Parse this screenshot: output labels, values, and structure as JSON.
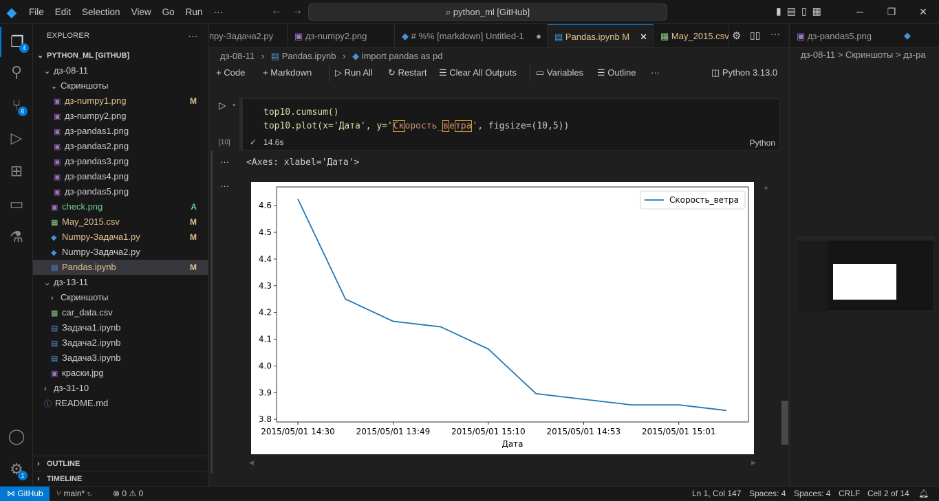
{
  "titlebar": {
    "menu": [
      "File",
      "Edit",
      "Selection",
      "View",
      "Go",
      "Run",
      "···"
    ],
    "search": "python_ml [GitHub]"
  },
  "activity": {
    "explorer_badge": "4",
    "scm_badge": "6",
    "settings_badge": "1"
  },
  "explorer": {
    "title": "EXPLORER",
    "dots": "···",
    "workspace": "PYTHON_ML [GITHUB]",
    "items": [
      {
        "label": "дз-08-11",
        "badge": ""
      },
      {
        "label": "Скриншоты",
        "badge": ""
      },
      {
        "label": "дз-numpy1.png",
        "badge": "M"
      },
      {
        "label": "дз-numpy2.png",
        "badge": ""
      },
      {
        "label": "дз-pandas1.png",
        "badge": ""
      },
      {
        "label": "дз-pandas2.png",
        "badge": ""
      },
      {
        "label": "дз-pandas3.png",
        "badge": ""
      },
      {
        "label": "дз-pandas4.png",
        "badge": ""
      },
      {
        "label": "дз-pandas5.png",
        "badge": ""
      },
      {
        "label": "check.png",
        "badge": "A"
      },
      {
        "label": "May_2015.csv",
        "badge": "M"
      },
      {
        "label": "Numpy-Задача1.py",
        "badge": "M"
      },
      {
        "label": "Numpy-Задача2.py",
        "badge": ""
      },
      {
        "label": "Pandas.ipynb",
        "badge": "M"
      },
      {
        "label": "дз-13-11",
        "badge": ""
      },
      {
        "label": "Скриншоты",
        "badge": ""
      },
      {
        "label": "car_data.csv",
        "badge": ""
      },
      {
        "label": "Задача1.ipynb",
        "badge": ""
      },
      {
        "label": "Задача2.ipynb",
        "badge": ""
      },
      {
        "label": "Задача3.ipynb",
        "badge": ""
      },
      {
        "label": "краски.jpg",
        "badge": ""
      },
      {
        "label": "дз-31-10",
        "badge": ""
      },
      {
        "label": "README.md",
        "badge": ""
      }
    ],
    "outline": "OUTLINE",
    "timeline": "TIMELINE"
  },
  "tabs": [
    {
      "label": "пру-Задача2.py"
    },
    {
      "label": "дз-numpy2.png"
    },
    {
      "label": "# %% [markdown]  Untitled-1"
    },
    {
      "label": "Pandas.ipynb  M"
    },
    {
      "label": "May_2015.csv"
    }
  ],
  "breadcrumb": {
    "folder": "дз-08-11",
    "file": "Pandas.ipynb",
    "cell": "import pandas as pd"
  },
  "toolbar": {
    "code": "Code",
    "markdown": "Markdown",
    "runall": "Run All",
    "restart": "Restart",
    "clear": "Clear All Outputs",
    "variables": "Variables",
    "outline": "Outline",
    "dots": "···",
    "kernel": "Python 3.13.0"
  },
  "cell": {
    "line1": "top10.cumsum()",
    "line2_pre": "top10.plot(x='Дата', y='",
    "line2_hl1": "Ск",
    "line2_mid1": "орость_",
    "line2_hl2": "в",
    "line2_mid2": "е",
    "line2_hl3": "тра",
    "line2_post": "', figsize=(10,5))",
    "exec_count": "[10]",
    "time": "14.6s",
    "lang": "Python",
    "output_text": "<Axes: xlabel='Дата'>"
  },
  "right": {
    "tab": "дз-pandas5.png",
    "crumb": "дз-08-11 > Скриншоты > дз-pa"
  },
  "chart_data": {
    "type": "line",
    "categories": [
      "2015/05/01 14:30",
      "",
      "2015/05/01 13:49",
      "",
      "2015/05/01 15:10",
      "",
      "2015/05/01 14:53",
      "",
      "2015/05/01 15:01",
      ""
    ],
    "xticks": [
      "2015/05/01 14:30",
      "2015/05/01 13:49",
      "2015/05/01 15:10",
      "2015/05/01 14:53",
      "2015/05/01 15:01"
    ],
    "series": [
      {
        "name": "Скорость_ветра",
        "values": [
          4.625,
          4.25,
          4.167,
          4.146,
          4.063,
          3.896,
          3.875,
          3.854,
          3.854,
          3.833
        ]
      }
    ],
    "xlabel": "Дата",
    "ylabel": "",
    "yticks": [
      "3.8",
      "3.9",
      "4.0",
      "4.1",
      "4.2",
      "4.3",
      "4.4",
      "4.5",
      "4.6"
    ],
    "ylim": [
      3.79,
      4.67
    ],
    "line_color": "#1f77b4",
    "legend": "top-right",
    "grid": false
  },
  "statusbar": {
    "remote": "GitHub",
    "branch": "main*",
    "problems": "0",
    "warnings": "0",
    "position": "Ln 1, Col 147",
    "spaces1": "Spaces: 4",
    "spaces2": "Spaces: 4",
    "eol": "CRLF",
    "cell": "Cell 2 of 14"
  }
}
